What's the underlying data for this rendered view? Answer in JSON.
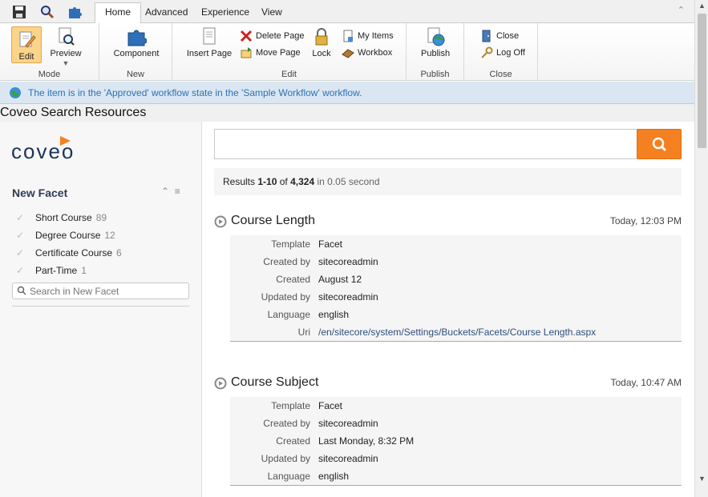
{
  "ribbon": {
    "tabs": [
      {
        "label": "Home"
      },
      {
        "label": "Advanced"
      },
      {
        "label": "Experience"
      },
      {
        "label": "View"
      }
    ],
    "groups": {
      "mode": {
        "label": "Mode",
        "edit": "Edit",
        "preview": "Preview"
      },
      "new": {
        "label": "New",
        "component": "Component"
      },
      "edit": {
        "label": "Edit",
        "insert_page": "Insert Page",
        "delete_page": "Delete Page",
        "move_page": "Move Page",
        "lock": "Lock",
        "my_items": "My Items",
        "workbox": "Workbox"
      },
      "publish": {
        "label": "Publish",
        "publish": "Publish"
      },
      "close": {
        "label": "Close",
        "close": "Close",
        "log_off": "Log Off"
      }
    }
  },
  "workflow": {
    "message": "The item is in the 'Approved' workflow state in the 'Sample Workflow' workflow."
  },
  "page_title": "Coveo Search Resources",
  "logo_text": "coveo",
  "facet": {
    "title": "New Facet",
    "items": [
      {
        "label": "Short Course",
        "count": "89"
      },
      {
        "label": "Degree Course",
        "count": "12"
      },
      {
        "label": "Certificate Course",
        "count": "6"
      },
      {
        "label": "Part-Time",
        "count": "1"
      }
    ],
    "search_placeholder": "Search in New Facet"
  },
  "search": {
    "value": ""
  },
  "summary": {
    "prefix": "Results",
    "range": "1-10",
    "of": "of",
    "total": "4,324",
    "suffix": "in 0.05 second"
  },
  "results": [
    {
      "title": "Course Length",
      "date": "Today, 12:03 PM",
      "fields": [
        {
          "k": "Template",
          "v": "Facet"
        },
        {
          "k": "Created by",
          "v": "sitecoreadmin"
        },
        {
          "k": "Created",
          "v": "August 12"
        },
        {
          "k": "Updated by",
          "v": "sitecoreadmin"
        },
        {
          "k": "Language",
          "v": "english"
        },
        {
          "k": "Uri",
          "v": "/en/sitecore/system/Settings/Buckets/Facets/Course Length.aspx"
        }
      ]
    },
    {
      "title": "Course Subject",
      "date": "Today, 10:47 AM",
      "fields": [
        {
          "k": "Template",
          "v": "Facet"
        },
        {
          "k": "Created by",
          "v": "sitecoreadmin"
        },
        {
          "k": "Created",
          "v": "Last Monday, 8:32 PM"
        },
        {
          "k": "Updated by",
          "v": "sitecoreadmin"
        },
        {
          "k": "Language",
          "v": "english"
        }
      ]
    }
  ],
  "colors": {
    "accent": "#f58020",
    "workflow_text": "#2e70b2",
    "facet_title": "#2e3d54",
    "logo": "#1d3557"
  }
}
